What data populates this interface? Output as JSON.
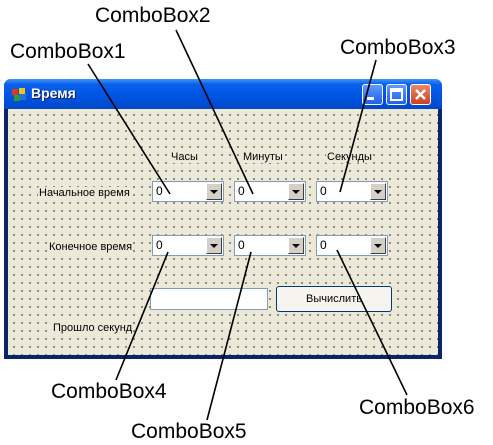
{
  "window": {
    "title": "Время",
    "app_icon": "delphi-app-icon",
    "controls": [
      "minimize-icon",
      "maximize-icon",
      "close-icon"
    ]
  },
  "form": {
    "col_hours": "Часы",
    "col_minutes": "Минуты",
    "col_seconds": "Секунды",
    "start_label": "Начальное время",
    "end_label": "Конечное время",
    "elapsed_label": "Прошло секунд",
    "elapsed_value": "",
    "calc_button": "Вычислить"
  },
  "combos": {
    "start": [
      {
        "value": "0"
      },
      {
        "value": "0"
      },
      {
        "value": "0"
      }
    ],
    "end": [
      {
        "value": "0"
      },
      {
        "value": "0"
      },
      {
        "value": "0"
      }
    ]
  },
  "callouts": [
    "ComboBox1",
    "ComboBox2",
    "ComboBox3",
    "ComboBox4",
    "ComboBox5",
    "ComboBox6"
  ],
  "colors": {
    "titlebar": "#0054e3",
    "client_bg": "#ece9d8",
    "close_button": "#c8401f"
  }
}
